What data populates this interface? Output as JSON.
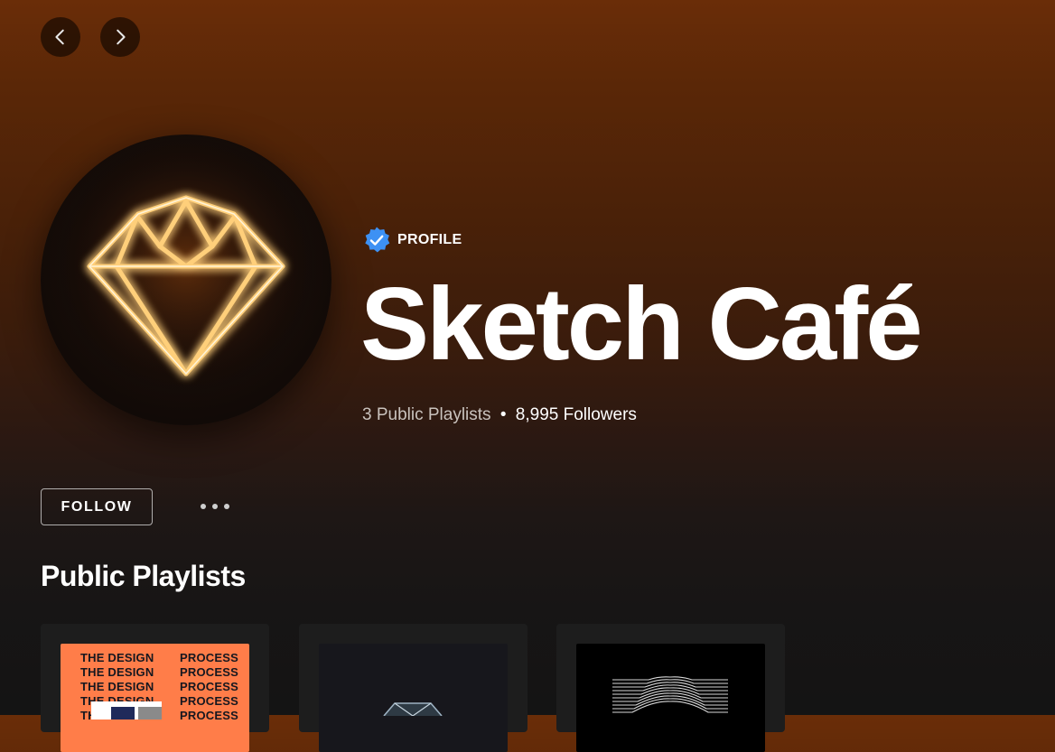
{
  "nav": {
    "back_icon": "chevron-left-icon",
    "forward_icon": "chevron-right-icon"
  },
  "profile": {
    "type_label": "PROFILE",
    "verified_icon": "verified-badge-icon",
    "name": "Sketch Café",
    "playlists_count": "3 Public Playlists",
    "separator": "•",
    "followers": "8,995 Followers",
    "avatar_icon": "neon-diamond-logo-icon"
  },
  "actions": {
    "follow_label": "FOLLOW",
    "more_icon": "more-dots-icon"
  },
  "playlists_section": {
    "title": "Public Playlists",
    "cards": [
      {
        "cover": "design-process-cover",
        "lines": [
          {
            "left": "THE DESIGN",
            "right": "PROCESS"
          },
          {
            "left": "THE DESIGN",
            "right": "PROCESS"
          },
          {
            "left": "THE DESIGN",
            "right": "PROCESS"
          },
          {
            "left": "THE DESIGN",
            "right": "PROCESS"
          },
          {
            "left": "THE DESIGN",
            "right": "PROCESS"
          }
        ]
      },
      {
        "cover": "dark-diamond-cover"
      },
      {
        "cover": "wave-lines-cover"
      }
    ]
  },
  "colors": {
    "header_top": "#6a2d08",
    "background": "#141414",
    "neon": "#ffb347",
    "verified_blue": "#3d91f4",
    "design_cover": "#ff7d49"
  }
}
